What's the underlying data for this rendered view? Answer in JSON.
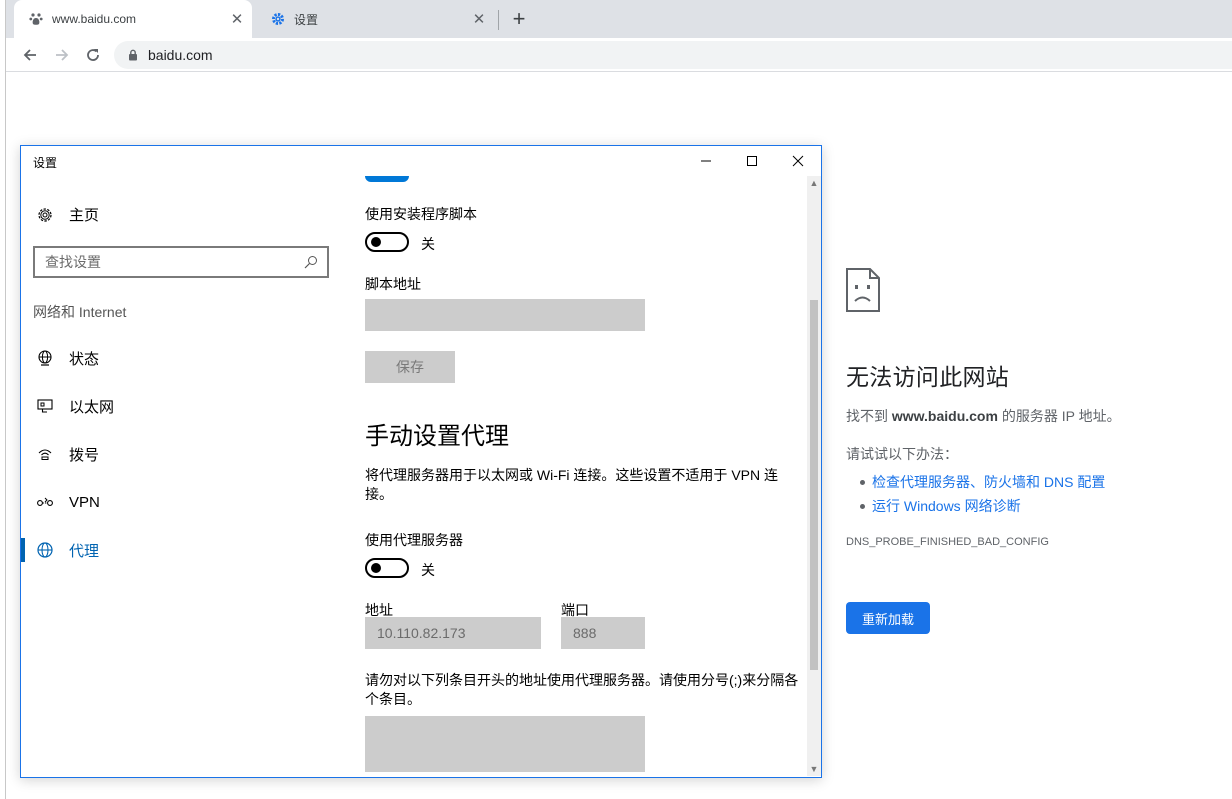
{
  "browser": {
    "tabs": [
      {
        "title": "www.baidu.com",
        "icon": "paw-icon",
        "active": true
      },
      {
        "title": "设置",
        "icon": "gear-icon",
        "active": false
      }
    ],
    "url": "baidu.com"
  },
  "error_page": {
    "title": "无法访问此网站",
    "message_prefix": "找不到 ",
    "message_host": "www.baidu.com",
    "message_suffix": " 的服务器 IP 地址。",
    "try_label": "请试试以下办法：",
    "suggestions": [
      "检查代理服务器、防火墙和 DNS 配置",
      "运行 Windows 网络诊断"
    ],
    "error_code": "DNS_PROBE_FINISHED_BAD_CONFIG",
    "reload_label": "重新加载"
  },
  "settings_window": {
    "title": "设置",
    "sidebar": {
      "home_label": "主页",
      "search_placeholder": "查找设置",
      "section_label": "网络和 Internet",
      "items": [
        {
          "label": "状态",
          "icon": "globe-status-icon"
        },
        {
          "label": "以太网",
          "icon": "ethernet-icon"
        },
        {
          "label": "拨号",
          "icon": "dialup-icon"
        },
        {
          "label": "VPN",
          "icon": "vpn-icon"
        },
        {
          "label": "代理",
          "icon": "globe-icon",
          "selected": true
        }
      ]
    },
    "content": {
      "setup_script_label": "使用安装程序脚本",
      "setup_script_toggle_state": "关",
      "script_address_label": "脚本地址",
      "save_label": "保存",
      "manual_heading": "手动设置代理",
      "manual_desc": "将代理服务器用于以太网或 Wi-Fi 连接。这些设置不适用于 VPN 连接。",
      "use_proxy_label": "使用代理服务器",
      "use_proxy_toggle_state": "关",
      "address_label": "地址",
      "address_value": "10.110.82.173",
      "port_label": "端口",
      "port_value": "888",
      "exceptions_desc": "请勿对以下列条目开头的地址使用代理服务器。请使用分号(;)来分隔各个条目。"
    }
  },
  "colors": {
    "accent_blue": "#1a73e8",
    "windows_accent": "#0063b1",
    "tabstrip_bg": "#dee1e6",
    "disabled_fill": "#cccccc"
  }
}
